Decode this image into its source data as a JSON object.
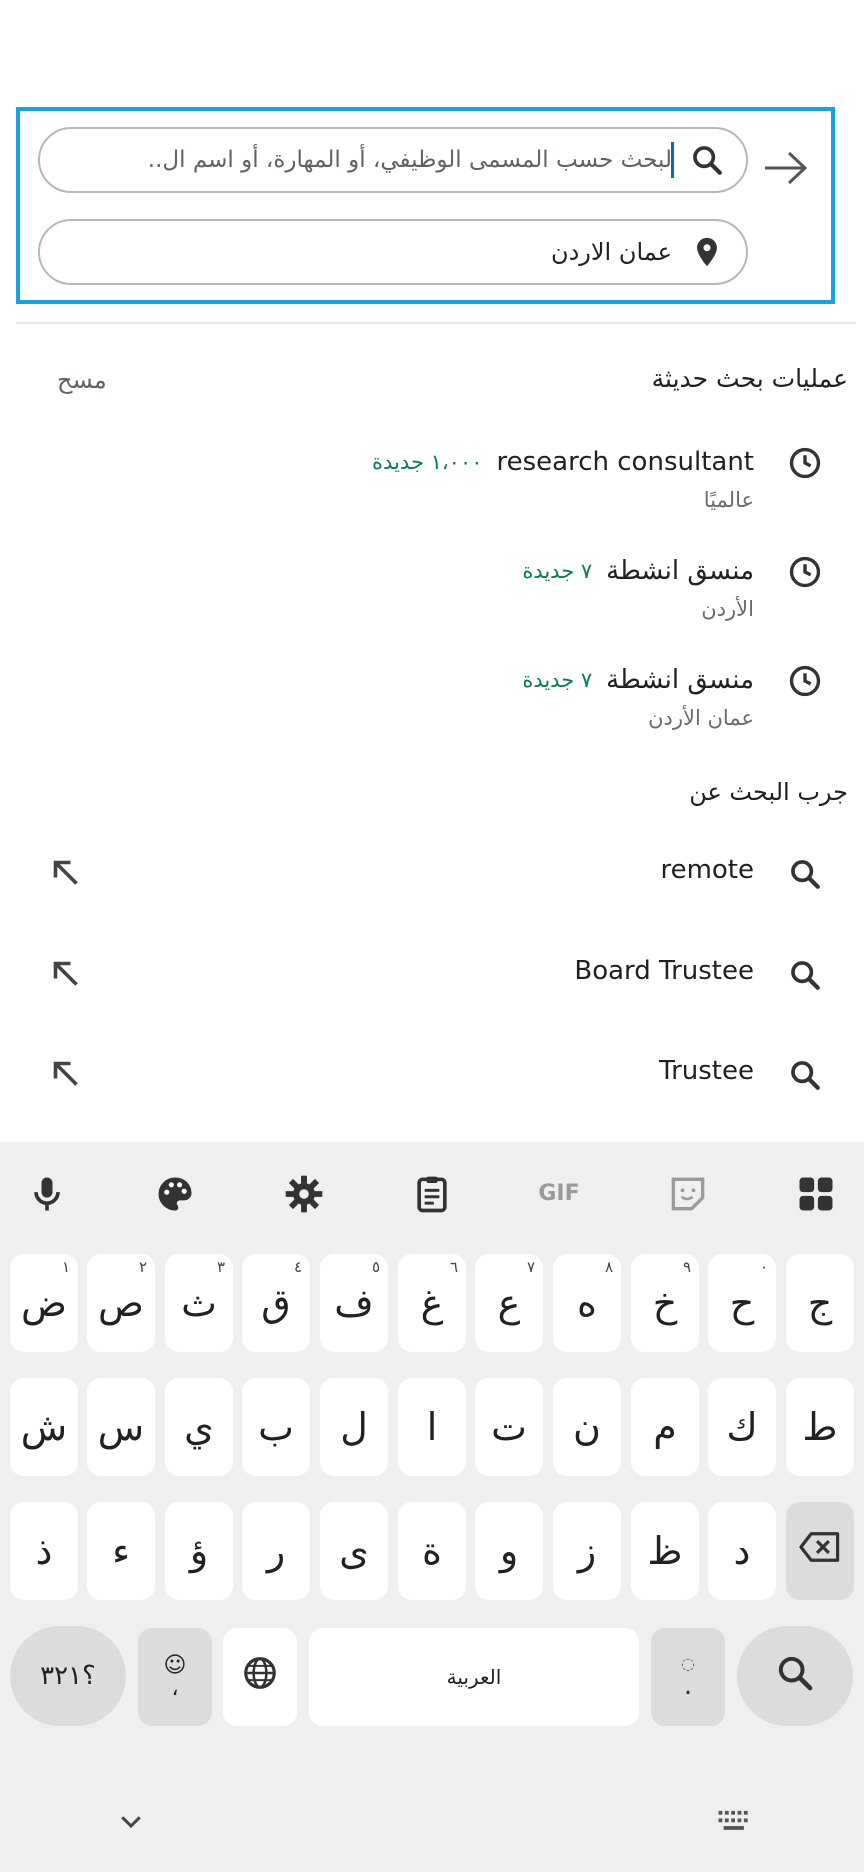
{
  "search": {
    "keyword_placeholder": "لبحث حسب المسمى الوظيفي، أو المهارة، أو اسم ال..",
    "location_value": "عمان الاردن"
  },
  "recent": {
    "title": "عمليات بحث حديثة",
    "clear_label": "مسح",
    "items": [
      {
        "term": "research consultant",
        "new_count": "١،٠٠٠ جديدة",
        "location": "عالميًا"
      },
      {
        "term": "منسق انشطة",
        "new_count": "٧ جديدة",
        "location": "الأردن"
      },
      {
        "term": "منسق انشطة",
        "new_count": "٧ جديدة",
        "location": "عمان الأردن"
      }
    ]
  },
  "suggestions": {
    "title": "جرب البحث عن",
    "items": [
      {
        "term": "remote"
      },
      {
        "term": "Board Trustee"
      },
      {
        "term": "Trustee"
      }
    ]
  },
  "keyboard": {
    "toolbar": [
      "grid-icon",
      "sticker-icon",
      "gif-icon",
      "clipboard-icon",
      "settings-icon",
      "palette-icon",
      "mic-icon"
    ],
    "row1": [
      {
        "k": "ج",
        "h": ""
      },
      {
        "k": "ح",
        "h": "٠"
      },
      {
        "k": "خ",
        "h": "٩"
      },
      {
        "k": "ه",
        "h": "٨"
      },
      {
        "k": "ع",
        "h": "٧"
      },
      {
        "k": "غ",
        "h": "٦"
      },
      {
        "k": "ف",
        "h": "٥"
      },
      {
        "k": "ق",
        "h": "٤"
      },
      {
        "k": "ث",
        "h": "٣"
      },
      {
        "k": "ص",
        "h": "٢"
      },
      {
        "k": "ض",
        "h": "١"
      }
    ],
    "row2": [
      "ط",
      "ك",
      "م",
      "ن",
      "ت",
      "ا",
      "ل",
      "ب",
      "ي",
      "س",
      "ش"
    ],
    "row3": [
      "د",
      "ظ",
      "ز",
      "و",
      "ة",
      "ى",
      "ر",
      "ؤ",
      "ء",
      "ذ"
    ],
    "symbols_label": "؟٣٢١",
    "emoji_comma_label": "،",
    "space_label": "العربية",
    "period_label": ".",
    "accent_color": "#16a3e0",
    "new_color": "#0a7c55"
  }
}
